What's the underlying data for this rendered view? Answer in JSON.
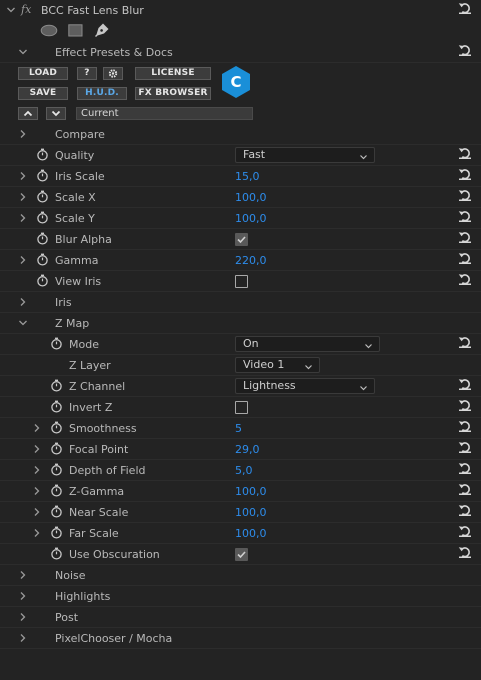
{
  "header": {
    "fx_label": "fx",
    "effect_name": "BCC Fast Lens Blur"
  },
  "presets": {
    "title": "Effect Presets & Docs",
    "load": "LOAD",
    "help": "?",
    "license": "LICENSE",
    "save": "SAVE",
    "hud": "H.U.D.",
    "fx_browser": "FX BROWSER",
    "current_preset": "Current",
    "logo_letter": "C"
  },
  "params": {
    "compare": "Compare",
    "quality_label": "Quality",
    "quality_value": "Fast",
    "iris_scale_label": "Iris Scale",
    "iris_scale_value": "15,0",
    "scale_x_label": "Scale X",
    "scale_x_value": "100,0",
    "scale_y_label": "Scale Y",
    "scale_y_value": "100,0",
    "blur_alpha_label": "Blur Alpha",
    "blur_alpha_checked": true,
    "gamma_label": "Gamma",
    "gamma_value": "220,0",
    "view_iris_label": "View Iris",
    "view_iris_checked": false,
    "iris": "Iris"
  },
  "zmap": {
    "title": "Z Map",
    "mode_label": "Mode",
    "mode_value": "On",
    "z_layer_label": "Z Layer",
    "z_layer_value": "Video 1",
    "z_channel_label": "Z Channel",
    "z_channel_value": "Lightness",
    "invert_z_label": "Invert Z",
    "invert_z_checked": false,
    "smoothness_label": "Smoothness",
    "smoothness_value": "5",
    "focal_point_label": "Focal Point",
    "focal_point_value": "29,0",
    "dof_label": "Depth of Field",
    "dof_value": "5,0",
    "zgamma_label": "Z-Gamma",
    "zgamma_value": "100,0",
    "near_scale_label": "Near Scale",
    "near_scale_value": "100,0",
    "far_scale_label": "Far Scale",
    "far_scale_value": "100,0",
    "use_obscuration_label": "Use Obscuration",
    "use_obscuration_checked": true
  },
  "groups": {
    "noise": "Noise",
    "highlights": "Highlights",
    "post": "Post",
    "pixelchooser": "PixelChooser / Mocha"
  },
  "colors": {
    "background": "#232323",
    "value_blue": "#2d8ceb",
    "logo_blue": "#1a8fd8",
    "text": "#b9b9b9"
  },
  "icons": {
    "chevron_closed": "chevron-right-icon",
    "chevron_open": "chevron-down-icon",
    "stopwatch": "stopwatch-icon",
    "reset": "reset-icon",
    "ellipse_mask": "ellipse-mask-icon",
    "rect_mask": "rectangle-mask-icon",
    "pen_mask": "pen-mask-icon",
    "gear": "gear-icon",
    "arrow_up": "arrow-up-icon",
    "arrow_down": "arrow-down-icon"
  }
}
